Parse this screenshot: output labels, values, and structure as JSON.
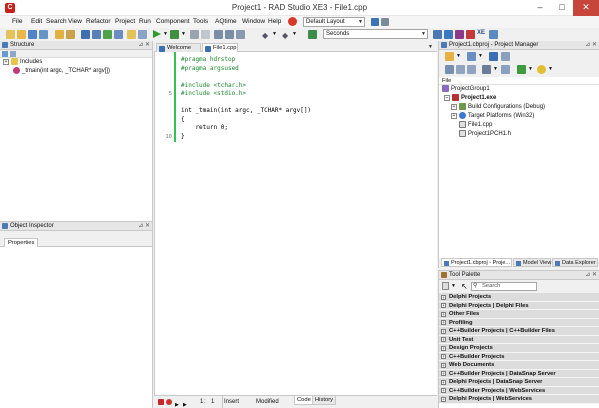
{
  "window": {
    "title": "Project1 - RAD Studio XE3 - File1.cpp"
  },
  "menu": [
    "File",
    "Edit",
    "Search",
    "View",
    "Refactor",
    "Project",
    "Run",
    "Component",
    "Tools",
    "AQtime",
    "Window",
    "Help"
  ],
  "layout_combo": "Default Layout",
  "seconds_combo": "Seconds",
  "structure": {
    "title": "Structure",
    "items": [
      "Includes",
      "_tmain(int argc, _TCHAR* argv[])"
    ]
  },
  "object_inspector": {
    "title": "Object Inspector",
    "tab": "Properties"
  },
  "editor": {
    "tabs": [
      "Welcome Page",
      "File1.cpp"
    ],
    "lines": [
      {
        "n": "",
        "text": "#pragma hdrstop",
        "cls": "c-pre"
      },
      {
        "n": "",
        "text": "#pragma argsused",
        "cls": "c-pre"
      },
      {
        "n": "",
        "text": "",
        "cls": ""
      },
      {
        "n": "",
        "text": "#include <tchar.h>",
        "cls": "c-pre"
      },
      {
        "n": "5",
        "text": "#include <stdio.h>",
        "cls": "c-pre"
      },
      {
        "n": "",
        "text": "",
        "cls": ""
      },
      {
        "n": "",
        "text": "int _tmain(int argc, _TCHAR* argv[])",
        "cls": "c-punc"
      },
      {
        "n": "",
        "text": "{",
        "cls": "c-punc"
      },
      {
        "n": "",
        "text": "    return 0;",
        "cls": "c-punc"
      },
      {
        "n": "10",
        "text": "}",
        "cls": "c-punc"
      }
    ]
  },
  "status": {
    "pos_line": "1",
    "pos_col": "1",
    "mode": "Insert",
    "state": "Modified",
    "tab_code": "Code",
    "tab_history": "History"
  },
  "project_manager": {
    "title": "Project1.cbproj - Project Manager",
    "file_label": "File",
    "items": [
      "ProjectGroup1",
      "Project1.exe",
      "Build Configurations (Debug)",
      "Target Platforms (Win32)",
      "File1.cpp",
      "Project1PCH1.h"
    ]
  },
  "right_tabs": [
    "Project1.cbproj - Proje...",
    "Model View",
    "Data Explorer"
  ],
  "tool_palette": {
    "title": "Tool Palette",
    "search_placeholder": "Search",
    "categories": [
      "Delphi Projects",
      "Delphi Projects | Delphi Files",
      "Other Files",
      "Profiling",
      "C++Builder Projects | C++Builder Files",
      "Unit Test",
      "Design Projects",
      "C++Builder Projects",
      "Web Documents",
      "C++Builder Projects | DataSnap Server",
      "Delphi Projects | DataSnap Server",
      "C++Builder Projects | WebServices",
      "Delphi Projects | WebServices"
    ]
  }
}
